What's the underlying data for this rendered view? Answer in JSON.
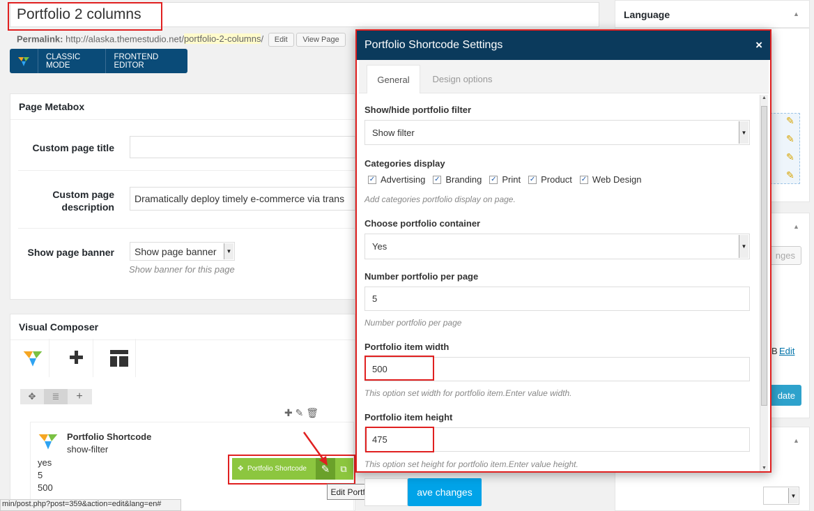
{
  "editor": {
    "title": "Portfolio 2 columns",
    "permalink_label": "Permalink:",
    "permalink_base": "http://alaska.themestudio.net/",
    "permalink_slug": "portfolio-2-columns",
    "permalink_end": "/",
    "edit_label": "Edit",
    "view_label": "View Page",
    "classic_mode": "CLASSIC MODE",
    "frontend_editor": "FRONTEND EDITOR"
  },
  "page_metabox": {
    "title": "Page Metabox",
    "custom_title_label": "Custom page title",
    "custom_title_value": "",
    "custom_desc_label": "Custom page description",
    "custom_desc_value": "Dramatically deploy timely e-commerce via trans",
    "show_banner_label": "Show page banner",
    "show_banner_value": "Show page banner",
    "show_banner_hint": "Show banner for this page"
  },
  "visual_composer": {
    "title": "Visual Composer",
    "element_title": "Portfolio Shortcode",
    "element_param_1": "show-filter",
    "element_values": [
      "yes",
      "5",
      "500"
    ],
    "green_bar_label": "Portfolio Shortcode",
    "tooltip": "Edit Portfolio Shortcode"
  },
  "sidebar": {
    "language_title": "Language",
    "edit_link": "Edit",
    "partial_changes": "nges",
    "partial_update": "date",
    "partial_b": "B"
  },
  "modal": {
    "title": "Portfolio Shortcode Settings",
    "close": "×",
    "tabs": [
      "General",
      "Design options"
    ],
    "filter_label": "Show/hide portfolio filter",
    "filter_value": "Show filter",
    "categories_label": "Categories display",
    "categories": [
      "Advertising",
      "Branding",
      "Print",
      "Product",
      "Web Design"
    ],
    "categories_hint": "Add categories portfolio display on page.",
    "container_label": "Choose portfolio container",
    "container_value": "Yes",
    "per_page_label": "Number portfolio per page",
    "per_page_value": "5",
    "per_page_hint": "Number portfolio per page",
    "width_label": "Portfolio item width",
    "width_value": "500",
    "width_hint": "This option set width for portfolio item.Enter value width.",
    "height_label": "Portfolio item height",
    "height_value": "475",
    "height_hint": "This option set height for portfolio item.Enter value height.",
    "save_label": "Save changes",
    "save_visible": "ave changes"
  },
  "status_bar": {
    "url": "min/post.php?post=359&action=edit&lang=en#"
  },
  "colors": {
    "modal_header": "#0b3a5c",
    "vc_bar": "#0a4b78",
    "highlight": "#e02020",
    "green": "#8cc63f",
    "save_button": "#00a3e8"
  }
}
